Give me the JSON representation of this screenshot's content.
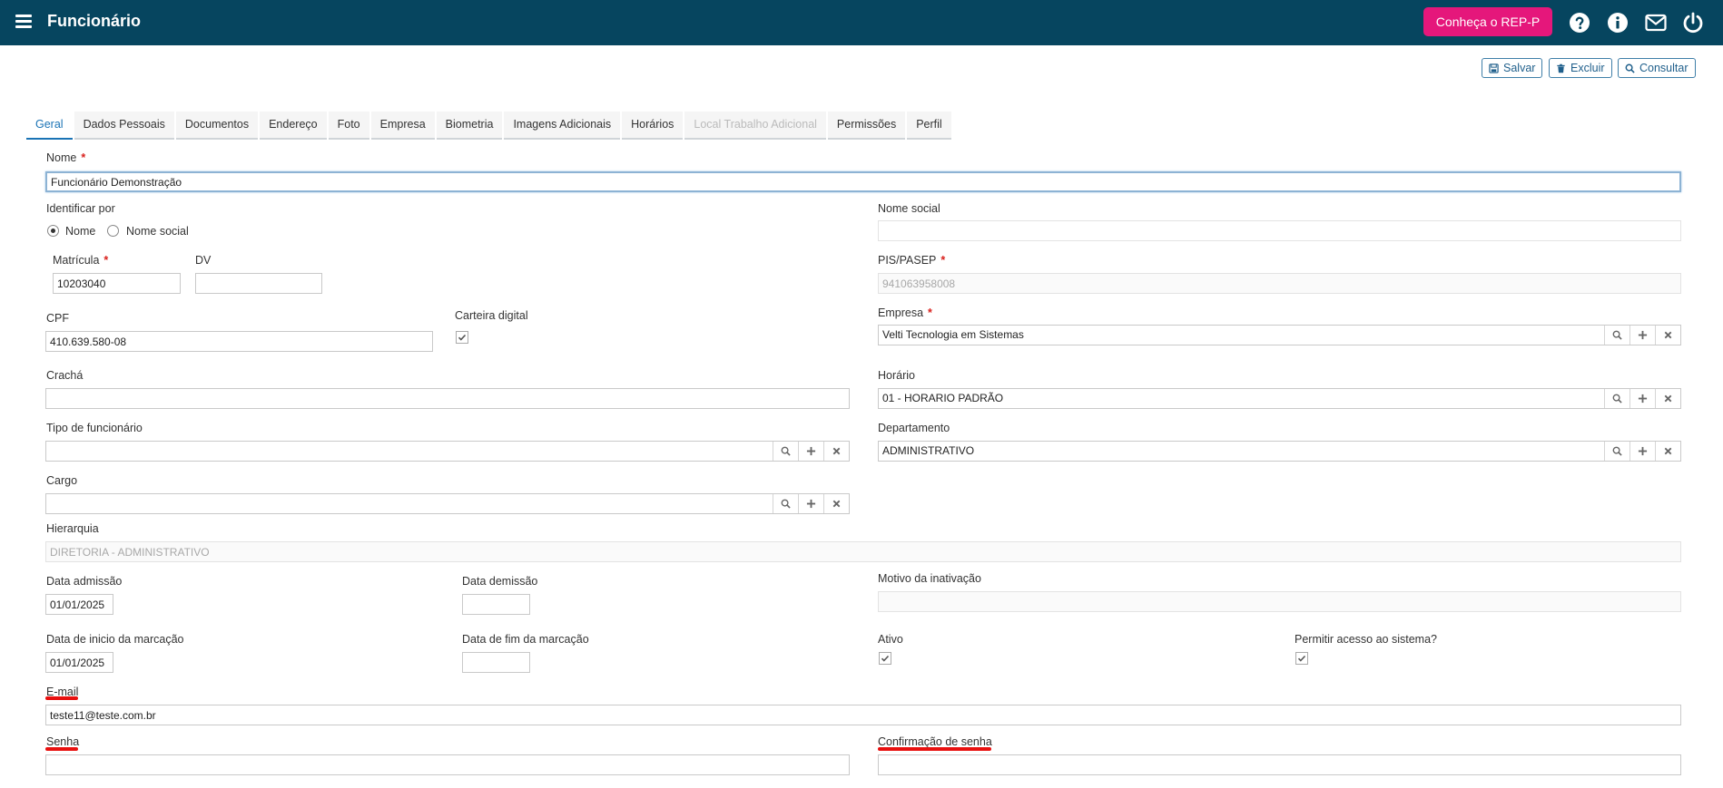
{
  "header": {
    "title": "Funcionário",
    "rep_button": "Conheça o REP-P",
    "icons": [
      "question-circle-icon",
      "info-circle-icon",
      "envelope-icon",
      "power-icon"
    ]
  },
  "toolbar": {
    "save": "Salvar",
    "delete": "Excluir",
    "search": "Consultar"
  },
  "tabs": [
    {
      "label": "Geral",
      "state": "active"
    },
    {
      "label": "Dados Pessoais"
    },
    {
      "label": "Documentos"
    },
    {
      "label": "Endereço"
    },
    {
      "label": "Foto"
    },
    {
      "label": "Empresa"
    },
    {
      "label": "Biometria"
    },
    {
      "label": "Imagens Adicionais"
    },
    {
      "label": "Horários"
    },
    {
      "label": "Local Trabalho Adicional",
      "state": "disabled"
    },
    {
      "label": "Permissões"
    },
    {
      "label": "Perfil"
    }
  ],
  "form": {
    "nome": {
      "label": "Nome",
      "required": "*",
      "value": "Funcionário Demonstração"
    },
    "identificar_por": {
      "label": "Identificar por",
      "options": [
        "Nome",
        "Nome social"
      ],
      "selected": "Nome"
    },
    "nome_social": {
      "label": "Nome social",
      "value": ""
    },
    "matricula": {
      "label": "Matrícula",
      "required": "*",
      "value": "10203040"
    },
    "dv": {
      "label": "DV",
      "value": ""
    },
    "pis_pasep": {
      "label": "PIS/PASEP",
      "required": "*",
      "value": "941063958008"
    },
    "cpf": {
      "label": "CPF",
      "value": "410.639.580-08"
    },
    "carteira_digital": {
      "label": "Carteira digital",
      "checked": true
    },
    "empresa": {
      "label": "Empresa",
      "required": "*",
      "value": "Velti Tecnologia em Sistemas"
    },
    "cracha": {
      "label": "Crachá",
      "value": ""
    },
    "horario": {
      "label": "Horário",
      "value": "01 - HORARIO PADRÃO"
    },
    "tipo_funcionario": {
      "label": "Tipo de funcionário",
      "value": ""
    },
    "departamento": {
      "label": "Departamento",
      "value": "ADMINISTRATIVO"
    },
    "cargo": {
      "label": "Cargo",
      "value": ""
    },
    "hierarquia": {
      "label": "Hierarquia",
      "value": "DIRETORIA - ADMINISTRATIVO"
    },
    "data_admissao": {
      "label": "Data admissão",
      "value": "01/01/2025"
    },
    "data_demissao": {
      "label": "Data demissão",
      "value": ""
    },
    "motivo_inativacao": {
      "label": "Motivo da inativação",
      "value": ""
    },
    "data_inicio_marcacao": {
      "label": "Data de inicio da marcação",
      "value": "01/01/2025"
    },
    "data_fim_marcacao": {
      "label": "Data de fim da marcação",
      "value": ""
    },
    "ativo": {
      "label": "Ativo",
      "checked": true
    },
    "permitir_acesso": {
      "label": "Permitir acesso ao sistema?",
      "checked": true
    },
    "email": {
      "label": "E-mail",
      "value": "teste11@teste.com.br"
    },
    "senha": {
      "label": "Senha",
      "value": ""
    },
    "confirmacao_senha": {
      "label": "Confirmação de senha",
      "value": ""
    }
  },
  "colors": {
    "topbar": "#06455f",
    "accent_pink": "#e5177b",
    "tab_active": "#1a73b5",
    "required": "#d9201c",
    "annotation_underline": "#e8100f"
  }
}
